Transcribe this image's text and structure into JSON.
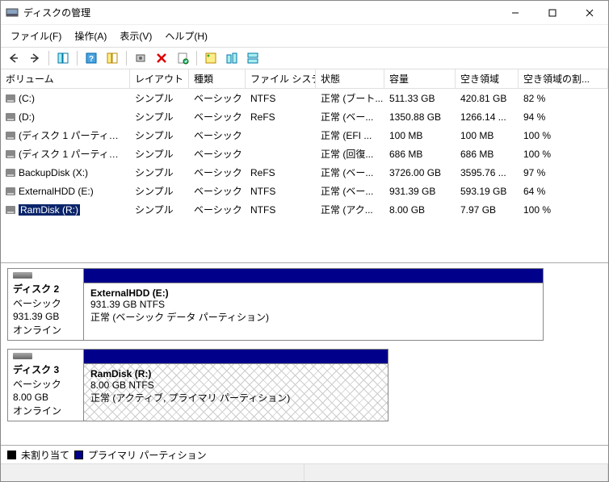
{
  "window": {
    "title": "ディスクの管理"
  },
  "menu": {
    "file": "ファイル(F)",
    "action": "操作(A)",
    "view": "表示(V)",
    "help": "ヘルプ(H)"
  },
  "columns": {
    "volume": "ボリューム",
    "layout": "レイアウト",
    "type": "種類",
    "fs": "ファイル システム",
    "status": "状態",
    "capacity": "容量",
    "free": "空き領域",
    "freepct": "空き領域の割..."
  },
  "volumes": [
    {
      "name": "(C:)",
      "layout": "シンプル",
      "type": "ベーシック",
      "fs": "NTFS",
      "status": "正常 (ブート...",
      "capacity": "511.33 GB",
      "free": "420.81 GB",
      "freepct": "82 %"
    },
    {
      "name": "(D:)",
      "layout": "シンプル",
      "type": "ベーシック",
      "fs": "ReFS",
      "status": "正常 (ベー...",
      "capacity": "1350.88 GB",
      "free": "1266.14 ...",
      "freepct": "94 %"
    },
    {
      "name": "(ディスク 1 パーティシ...",
      "layout": "シンプル",
      "type": "ベーシック",
      "fs": "",
      "status": "正常 (EFI ...",
      "capacity": "100 MB",
      "free": "100 MB",
      "freepct": "100 %"
    },
    {
      "name": "(ディスク 1 パーティシ...",
      "layout": "シンプル",
      "type": "ベーシック",
      "fs": "",
      "status": "正常 (回復...",
      "capacity": "686 MB",
      "free": "686 MB",
      "freepct": "100 %"
    },
    {
      "name": "BackupDisk (X:)",
      "layout": "シンプル",
      "type": "ベーシック",
      "fs": "ReFS",
      "status": "正常 (ベー...",
      "capacity": "3726.00 GB",
      "free": "3595.76 ...",
      "freepct": "97 %"
    },
    {
      "name": "ExternalHDD (E:)",
      "layout": "シンプル",
      "type": "ベーシック",
      "fs": "NTFS",
      "status": "正常 (ベー...",
      "capacity": "931.39 GB",
      "free": "593.19 GB",
      "freepct": "64 %"
    },
    {
      "name": "RamDisk (R:)",
      "layout": "シンプル",
      "type": "ベーシック",
      "fs": "NTFS",
      "status": "正常 (アク...",
      "capacity": "8.00 GB",
      "free": "7.97 GB",
      "freepct": "100 %"
    }
  ],
  "diskviews": {
    "disk2": {
      "header": "ディスク 2",
      "sub1": "ベーシック",
      "sub2": "931.39 GB",
      "sub3": "オンライン",
      "vol_name": "ExternalHDD  (E:)",
      "vol_size": "931.39 GB NTFS",
      "vol_status": "正常 (ベーシック データ パーティション)"
    },
    "disk3": {
      "header": "ディスク 3",
      "sub1": "ベーシック",
      "sub2": "8.00 GB",
      "sub3": "オンライン",
      "vol_name": "RamDisk  (R:)",
      "vol_size": "8.00 GB NTFS",
      "vol_status": "正常 (アクティブ, プライマリ パーティション)"
    }
  },
  "legend": {
    "unallocated": "未割り当て",
    "primary": "プライマリ パーティション"
  }
}
